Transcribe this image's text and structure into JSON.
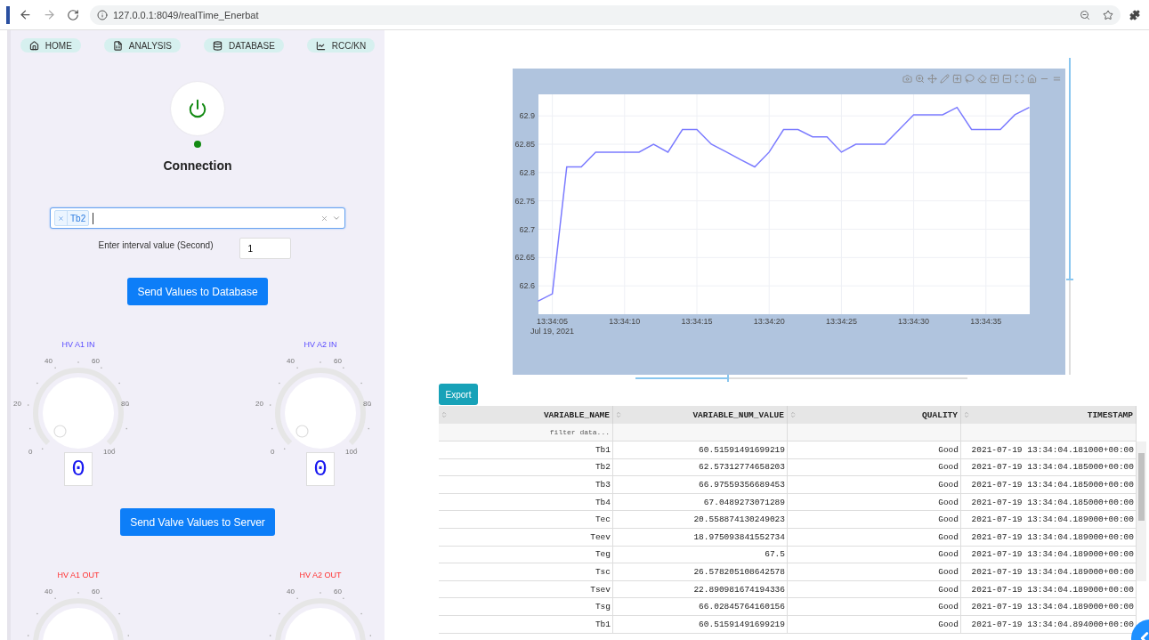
{
  "browser": {
    "url": "127.0.0.1:8049/realTime_Enerbat"
  },
  "nav": [
    {
      "label": "HOME",
      "kind": "home"
    },
    {
      "label": "ANALYSIS",
      "kind": "file"
    },
    {
      "label": "DATABASE",
      "kind": "database"
    },
    {
      "label": "RCC/KN",
      "kind": "chart"
    }
  ],
  "connection": {
    "label": "Connection",
    "on": true
  },
  "variable_select": {
    "tags": [
      "Tb2"
    ]
  },
  "interval": {
    "label": "Enter interval value (Second)",
    "value": "1"
  },
  "send_database_button": "Send Values to Database",
  "knobs_in": [
    {
      "label": "HV A1 IN",
      "readout": "0",
      "scale": [
        "0",
        "20",
        "40",
        "60",
        "80",
        "100"
      ]
    },
    {
      "label": "HV A2 IN",
      "readout": "0",
      "scale": [
        "0",
        "20",
        "40",
        "60",
        "80",
        "100"
      ]
    }
  ],
  "send_valve_button": "Send Valve Values to Server",
  "knobs_out": [
    {
      "label": "HV A1 OUT",
      "scale": [
        "40",
        "60"
      ]
    },
    {
      "label": "HV A2 OUT",
      "scale": [
        "40",
        "60"
      ]
    }
  ],
  "chart": {
    "chart_data": {
      "type": "line",
      "grid": true,
      "categories": [
        null,
        "13:34:05",
        null,
        null,
        null,
        null,
        "13:34:10",
        null,
        null,
        null,
        null,
        "13:34:15",
        null,
        null,
        null,
        null,
        "13:34:20",
        null,
        null,
        null,
        null,
        "13:34:25",
        null,
        null,
        null,
        null,
        "13:34:30",
        null,
        null,
        null,
        null,
        "13:34:35",
        null,
        null,
        null
      ],
      "series": [
        {
          "color": "#7b7bff",
          "values": [
            62.573,
            62.586,
            62.81,
            62.81,
            62.836,
            62.836,
            62.836,
            62.836,
            62.85,
            62.836,
            62.876,
            62.876,
            62.85,
            62.837,
            62.823,
            62.81,
            62.836,
            62.876,
            62.876,
            62.863,
            62.863,
            62.836,
            62.85,
            62.85,
            62.85,
            62.876,
            62.902,
            62.902,
            62.902,
            62.915,
            62.876,
            62.876,
            62.876,
            62.902,
            62.915
          ]
        }
      ],
      "ylim": [
        62.55,
        62.938
      ],
      "yticks": [
        62.6,
        62.65,
        62.7,
        62.75,
        62.8,
        62.85,
        62.9
      ],
      "annotations": [
        "Jul 19, 2021"
      ]
    },
    "sliders": [
      {
        "kind": "horizontal",
        "level": 0.28
      },
      {
        "kind": "vertical",
        "level": 0.7
      }
    ]
  },
  "export_button": "Export",
  "table": {
    "columns": [
      "VARIABLE_NAME",
      "VARIABLE_NUM_VALUE",
      "QUALITY",
      "TIMESTAMP"
    ],
    "filter_placeholder": "filter data...",
    "rows": [
      [
        "Tb1",
        "60.51591491699219",
        "Good",
        "2021-07-19 13:34:04.181000+00:00"
      ],
      [
        "Tb2",
        "62.57312774658203",
        "Good",
        "2021-07-19 13:34:04.185000+00:00"
      ],
      [
        "Tb3",
        "66.97559356689453",
        "Good",
        "2021-07-19 13:34:04.185000+00:00"
      ],
      [
        "Tb4",
        "67.0489273071289",
        "Good",
        "2021-07-19 13:34:04.185000+00:00"
      ],
      [
        "Tec",
        "20.558874130249023",
        "Good",
        "2021-07-19 13:34:04.189000+00:00"
      ],
      [
        "Teev",
        "18.975093841552734",
        "Good",
        "2021-07-19 13:34:04.189000+00:00"
      ],
      [
        "Teg",
        "67.5",
        "Good",
        "2021-07-19 13:34:04.189000+00:00"
      ],
      [
        "Tsc",
        "26.578205108642578",
        "Good",
        "2021-07-19 13:34:04.189000+00:00"
      ],
      [
        "Tsev",
        "22.890981674194336",
        "Good",
        "2021-07-19 13:34:04.189000+00:00"
      ],
      [
        "Tsg",
        "66.02845764160156",
        "Good",
        "2021-07-19 13:34:04.189000+00:00"
      ],
      [
        "Tb1",
        "60.51591491699219",
        "Good",
        "2021-07-19 13:34:04.894000+00:00"
      ]
    ]
  }
}
